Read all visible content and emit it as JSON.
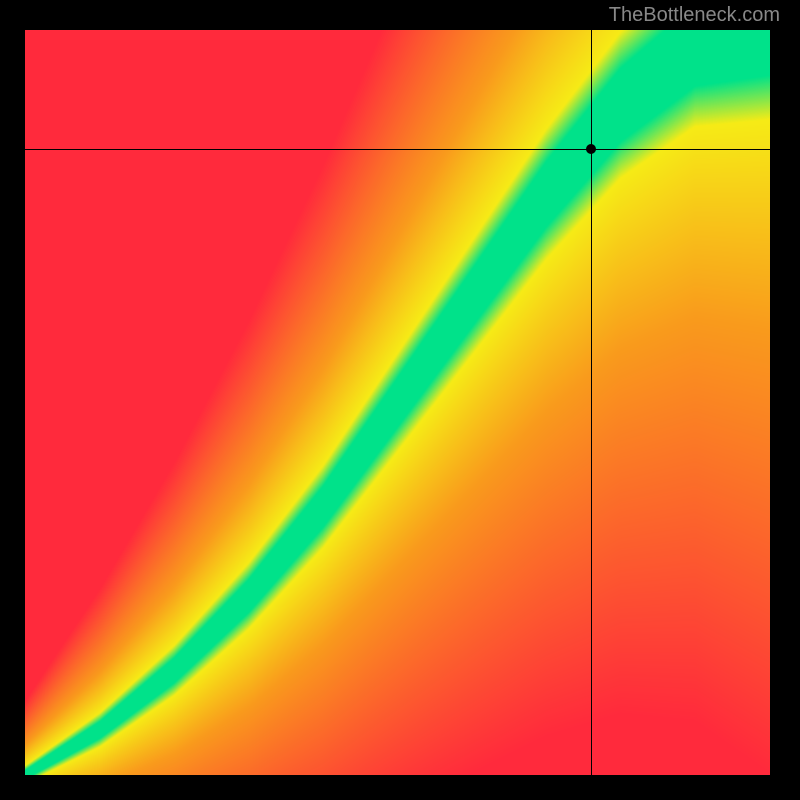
{
  "watermark": "TheBottleneck.com",
  "chart_data": {
    "type": "heatmap",
    "title": "",
    "xlabel": "",
    "ylabel": "",
    "xlim": [
      0,
      100
    ],
    "ylim": [
      0,
      100
    ],
    "crosshair": {
      "x": 76,
      "y": 84
    },
    "marker": {
      "x": 76,
      "y": 84
    },
    "optimal_curve": [
      {
        "x": 0,
        "y": 0
      },
      {
        "x": 10,
        "y": 6
      },
      {
        "x": 20,
        "y": 14
      },
      {
        "x": 30,
        "y": 24
      },
      {
        "x": 40,
        "y": 36
      },
      {
        "x": 50,
        "y": 50
      },
      {
        "x": 60,
        "y": 64
      },
      {
        "x": 70,
        "y": 78
      },
      {
        "x": 80,
        "y": 90
      },
      {
        "x": 90,
        "y": 98
      },
      {
        "x": 100,
        "y": 100
      }
    ],
    "colors": {
      "optimal": "#00E28A",
      "near": "#F6EB16",
      "mid": "#F99B1C",
      "far": "#FF2A3C"
    },
    "description": "Bottleneck heatmap: green diagonal band indicates balanced configurations; color shifts through yellow/orange to red as imbalance grows."
  }
}
